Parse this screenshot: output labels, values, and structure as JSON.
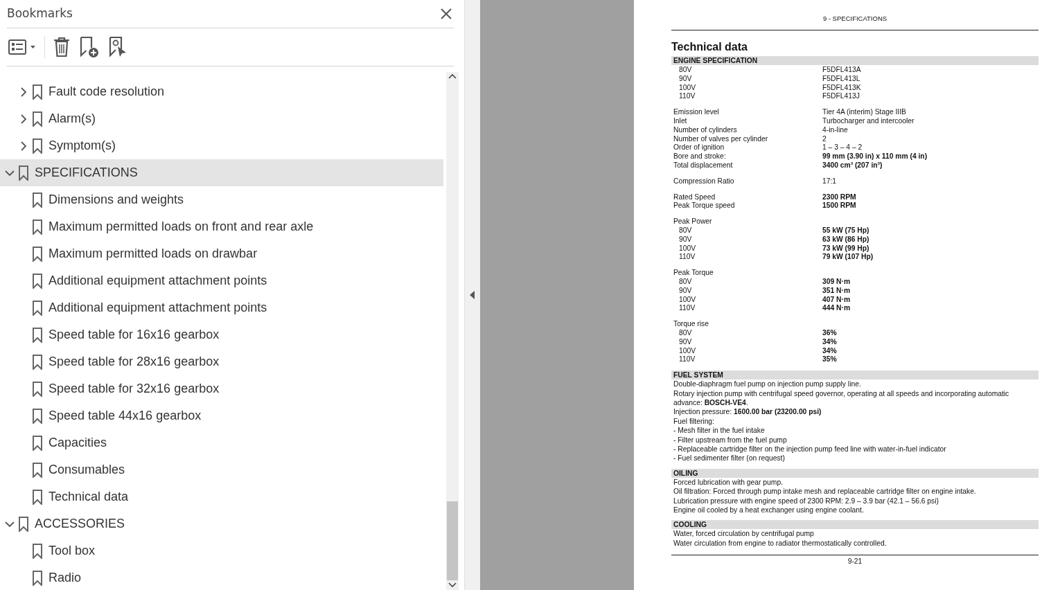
{
  "bookmarks_panel": {
    "title": "Bookmarks",
    "items": [
      {
        "children": [
          {
            "label": "Fault code resolution",
            "expanded": false,
            "selected": false
          },
          {
            "label": "Alarm(s)",
            "expanded": false,
            "selected": false
          },
          {
            "label": "Symptom(s)",
            "expanded": false,
            "selected": false
          }
        ]
      },
      {
        "label": "SPECIFICATIONS",
        "expanded": true,
        "selected": true,
        "children": [
          {
            "label": "Dimensions and weights",
            "selected": false
          },
          {
            "label": "Maximum permitted loads on front and rear axle",
            "selected": false
          },
          {
            "label": "Maximum permitted loads on drawbar",
            "selected": false
          },
          {
            "label": "Additional equipment attachment points",
            "selected": false
          },
          {
            "label": "Additional equipment attachment points",
            "selected": false
          },
          {
            "label": "Speed table for 16x16 gearbox",
            "selected": false
          },
          {
            "label": "Speed table for 28x16 gearbox",
            "selected": false
          },
          {
            "label": "Speed table for 32x16 gearbox",
            "selected": false
          },
          {
            "label": "Speed table 44x16 gearbox",
            "selected": false
          },
          {
            "label": "Capacities",
            "selected": false
          },
          {
            "label": "Consumables",
            "selected": false
          },
          {
            "label": "Technical data",
            "selected": false
          }
        ]
      },
      {
        "label": "ACCESSORIES",
        "expanded": true,
        "selected": false,
        "children": [
          {
            "label": "Tool box",
            "selected": false
          },
          {
            "label": "Radio",
            "selected": false
          }
        ]
      }
    ]
  },
  "document_page": {
    "running_header": "9 - SPECIFICATIONS",
    "title": "Technical data",
    "page_number": "9-21",
    "sections": [
      {
        "heading": "ENGINE SPECIFICATION",
        "kind": "table",
        "groups": [
          [
            {
              "label": "80V",
              "value": "F5DFL413A",
              "kind": "sub",
              "bold": false
            },
            {
              "label": "90V",
              "value": "F5DFL413L",
              "kind": "sub",
              "bold": false
            },
            {
              "label": "100V",
              "value": "F5DFL413K",
              "kind": "sub",
              "bold": false
            },
            {
              "label": "110V",
              "value": "F5DFL413J",
              "kind": "sub",
              "bold": false
            }
          ],
          [
            {
              "label": "Emission level",
              "value": "Tier 4A (interim) Stage IIIB",
              "kind": "main",
              "bold": false
            },
            {
              "label": "Inlet",
              "value": "Turbocharger and intercooler",
              "kind": "main",
              "bold": false
            },
            {
              "label": "Number of cylinders",
              "value": "4-in-line",
              "kind": "main",
              "bold": false
            },
            {
              "label": "Number of valves per cylinder",
              "value": "2",
              "kind": "main",
              "bold": false
            },
            {
              "label": "Order of ignition",
              "value": "1 – 3 – 4 – 2",
              "kind": "main",
              "bold": false
            },
            {
              "label": "Bore and stroke:",
              "value": "99 mm (3.90 in) x 110 mm (4 in)",
              "kind": "main",
              "bold": true
            },
            {
              "label": "Total displacement",
              "value": "3400 cm³ (207 in³)",
              "kind": "main",
              "bold": true
            }
          ],
          [
            {
              "label": "Compression Ratio",
              "value": "17:1",
              "kind": "main",
              "bold": false
            }
          ],
          [
            {
              "label": "Rated Speed",
              "value": "2300 RPM",
              "kind": "main",
              "bold": true
            },
            {
              "label": "Peak Torque speed",
              "value": "1500 RPM",
              "kind": "main",
              "bold": true
            }
          ],
          [
            {
              "label": "Peak Power",
              "kind": "main",
              "bold": false
            },
            {
              "label": "80V",
              "value": "55 kW (75 Hp)",
              "kind": "sub",
              "bold": true
            },
            {
              "label": "90V",
              "value": "63 kW (86 Hp)",
              "kind": "sub",
              "bold": true
            },
            {
              "label": "100V",
              "value": "73 kW (99 Hp)",
              "kind": "sub",
              "bold": true
            },
            {
              "label": "110V",
              "value": "79 kW (107 Hp)",
              "kind": "sub",
              "bold": true
            }
          ],
          [
            {
              "label": "Peak Torque",
              "kind": "main",
              "bold": false
            },
            {
              "label": "80V",
              "value": "309 N·m",
              "kind": "sub",
              "bold": true
            },
            {
              "label": "90V",
              "value": "351 N·m",
              "kind": "sub",
              "bold": true
            },
            {
              "label": "100V",
              "value": "407 N·m",
              "kind": "sub",
              "bold": true
            },
            {
              "label": "110V",
              "value": "444 N·m",
              "kind": "sub",
              "bold": true
            }
          ],
          [
            {
              "label": "Torque rise",
              "kind": "main",
              "bold": false
            },
            {
              "label": "80V",
              "value": "36%",
              "kind": "sub",
              "bold": true
            },
            {
              "label": "90V",
              "value": "34%",
              "kind": "sub",
              "bold": true
            },
            {
              "label": "100V",
              "value": "34%",
              "kind": "sub",
              "bold": true
            },
            {
              "label": "110V",
              "value": "35%",
              "kind": "sub",
              "bold": true
            }
          ]
        ]
      },
      {
        "heading": "FUEL SYSTEM",
        "kind": "text",
        "lines": [
          "Double-diaphragm fuel pump on injection pump supply line.",
          "Rotary injection pump with centrifugal speed governor, operating at all speeds and incorporating automatic advance:  **BOSCH-VE4**.",
          "Injection pressure:  **1600.00 bar (23200.00 psi)**",
          "Fuel filtering:",
          "-  Mesh filter in the fuel intake",
          "-  Filter upstream from the fuel pump",
          "-  Replaceable cartridge filter on the injection pump feed line with water-in-fuel indicator",
          "-  Fuel sedimenter filter (on request)"
        ]
      },
      {
        "heading": "OILING",
        "kind": "text",
        "lines": [
          "Forced lubrication with gear pump.",
          "Oil filtration: Forced through pump intake mesh and replaceable cartridge filter on engine intake.",
          "Lubrication pressure with engine speed of 2300 RPM: 2.9 – 3.9 bar (42.1 – 56.6 psi)",
          "Engine oil cooled by a heat exchanger using engine coolant."
        ]
      },
      {
        "heading": "COOLING",
        "kind": "text",
        "lines": [
          "Water, forced circulation by centrifugal pump",
          "Water circulation from engine to radiator thermostatically controlled."
        ]
      }
    ]
  }
}
